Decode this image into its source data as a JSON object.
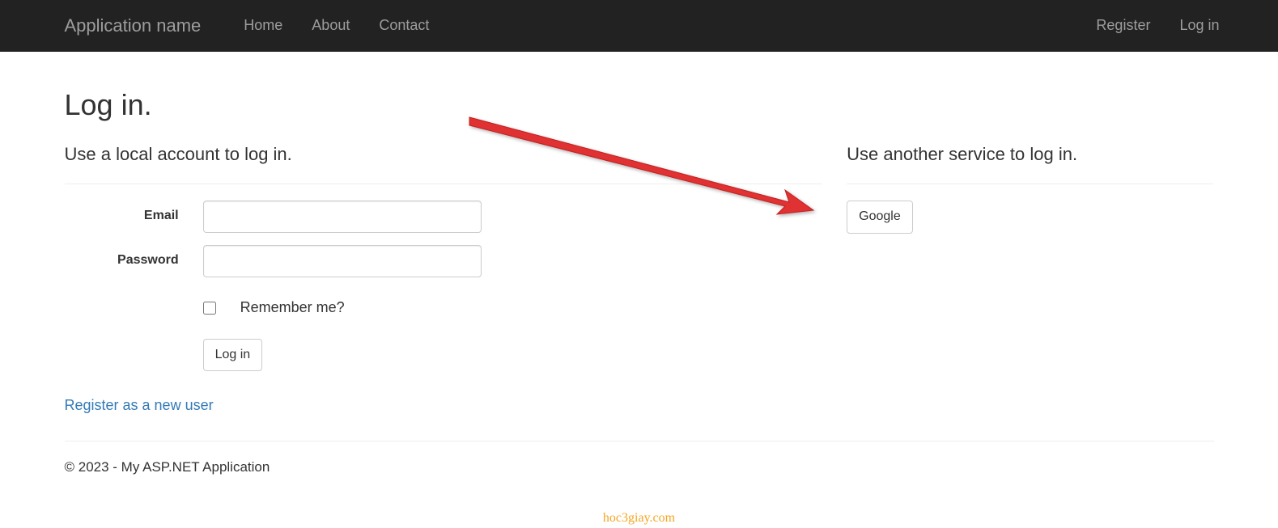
{
  "navbar": {
    "brand": "Application name",
    "nav_items": {
      "home": "Home",
      "about": "About",
      "contact": "Contact"
    },
    "right_items": {
      "register": "Register",
      "login": "Log in"
    }
  },
  "page": {
    "title": "Log in.",
    "local_section": {
      "heading": "Use a local account to log in.",
      "email_label": "Email",
      "email_value": "",
      "password_label": "Password",
      "password_value": "",
      "remember_label": "Remember me?",
      "submit_label": "Log in",
      "register_link": "Register as a new user"
    },
    "external_section": {
      "heading": "Use another service to log in.",
      "google_button": "Google"
    }
  },
  "footer": {
    "text": "© 2023 - My ASP.NET Application"
  },
  "watermark": "hoc3giay.com"
}
